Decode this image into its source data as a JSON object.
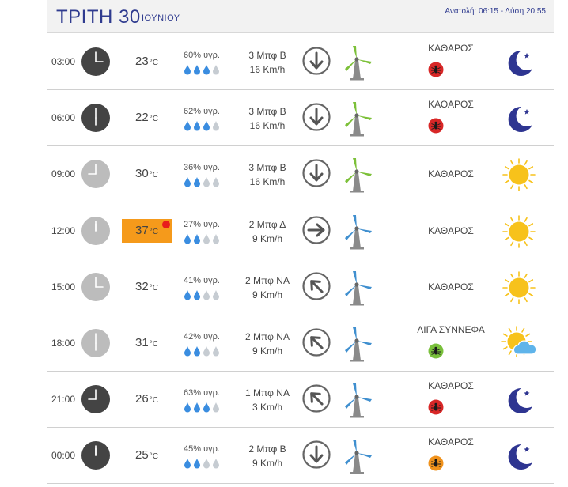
{
  "header": {
    "day": "ΤΡΙΤΗ 30",
    "month": "ΙΟΥΝΙΟΥ",
    "sun_info": "Ανατολή: 06:15 - Δύση 20:55"
  },
  "colors": {
    "night_clock": "#444444",
    "day_clock": "#bcbcbc",
    "hot_temp_bg": "#f59a1b",
    "header_text": "#2f3b8f",
    "drop_full": "#3a8de0",
    "drop_empty": "#c6ccd2",
    "dust_red": "#d82727",
    "dust_green": "#79c03b",
    "dust_orange": "#f0921c",
    "turbine_green": "#7cc039",
    "turbine_blue": "#3f8fcf",
    "moon": "#2e3591",
    "sun": "#f7c21b"
  },
  "rows": [
    {
      "time": "03:00",
      "hour": 3,
      "clock": "night",
      "temp": "23",
      "unit": "°C",
      "hot": false,
      "humidity": "60% υγρ.",
      "drops": 3,
      "wind_bft": "3 Μπφ Β",
      "wind_kmh": "16 Km/h",
      "wind_dir": "down",
      "turbine": "green",
      "condition": "ΚΑΘΑΡΟΣ",
      "dust": "red",
      "icon": "moon-icon"
    },
    {
      "time": "06:00",
      "hour": 6,
      "clock": "night",
      "temp": "22",
      "unit": "°C",
      "hot": false,
      "humidity": "62% υγρ.",
      "drops": 3,
      "wind_bft": "3 Μπφ Β",
      "wind_kmh": "16 Km/h",
      "wind_dir": "down",
      "turbine": "green",
      "condition": "ΚΑΘΑΡΟΣ",
      "dust": "red",
      "icon": "moon-icon"
    },
    {
      "time": "09:00",
      "hour": 9,
      "clock": "day",
      "temp": "30",
      "unit": "°C",
      "hot": false,
      "humidity": "36% υγρ.",
      "drops": 2,
      "wind_bft": "3 Μπφ Β",
      "wind_kmh": "16 Km/h",
      "wind_dir": "down",
      "turbine": "green",
      "condition": "ΚΑΘΑΡΟΣ",
      "dust": "none",
      "icon": "sun-icon"
    },
    {
      "time": "12:00",
      "hour": 12,
      "clock": "day",
      "temp": "37",
      "unit": "°C",
      "hot": true,
      "humidity": "27% υγρ.",
      "drops": 2,
      "wind_bft": "2 Μπφ Δ",
      "wind_kmh": "9 Km/h",
      "wind_dir": "right",
      "turbine": "blue",
      "condition": "ΚΑΘΑΡΟΣ",
      "dust": "none",
      "icon": "sun-icon"
    },
    {
      "time": "15:00",
      "hour": 3,
      "clock": "day",
      "temp": "32",
      "unit": "°C",
      "hot": false,
      "humidity": "41% υγρ.",
      "drops": 2,
      "wind_bft": "2 Μπφ ΝΑ",
      "wind_kmh": "9 Km/h",
      "wind_dir": "upleft",
      "turbine": "blue",
      "condition": "ΚΑΘΑΡΟΣ",
      "dust": "none",
      "icon": "sun-icon"
    },
    {
      "time": "18:00",
      "hour": 6,
      "clock": "day",
      "temp": "31",
      "unit": "°C",
      "hot": false,
      "humidity": "42% υγρ.",
      "drops": 2,
      "wind_bft": "2 Μπφ ΝΑ",
      "wind_kmh": "9 Km/h",
      "wind_dir": "upleft",
      "turbine": "blue",
      "condition": "ΛΙΓΑ ΣΥΝΝΕΦΑ",
      "dust": "green",
      "icon": "sun-cloud-icon"
    },
    {
      "time": "21:00",
      "hour": 9,
      "clock": "night",
      "temp": "26",
      "unit": "°C",
      "hot": false,
      "humidity": "63% υγρ.",
      "drops": 3,
      "wind_bft": "1 Μπφ ΝΑ",
      "wind_kmh": "3 Km/h",
      "wind_dir": "upleft",
      "turbine": "blue",
      "condition": "ΚΑΘΑΡΟΣ",
      "dust": "red",
      "icon": "moon-icon"
    },
    {
      "time": "00:00",
      "hour": 12,
      "clock": "night",
      "temp": "25",
      "unit": "°C",
      "hot": false,
      "humidity": "45% υγρ.",
      "drops": 2,
      "wind_bft": "2 Μπφ Β",
      "wind_kmh": "9 Km/h",
      "wind_dir": "down",
      "turbine": "blue",
      "condition": "ΚΑΘΑΡΟΣ",
      "dust": "orange",
      "icon": "moon-icon"
    }
  ]
}
